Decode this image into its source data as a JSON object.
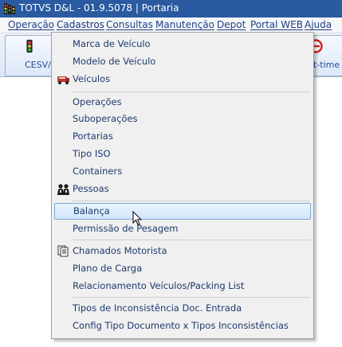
{
  "window": {
    "title": "TOTVS D&L - 01.9.5078 | Portaria"
  },
  "menubar": {
    "items": [
      "Operação",
      "Cadastros",
      "Consultas",
      "Manutenção",
      "Depot",
      "Portal WEB",
      "Ajuda"
    ]
  },
  "toolbar": {
    "left_label": "CESV/C",
    "right_label": "t-time"
  },
  "dropdown": {
    "items": [
      {
        "label": "Marca de Veículo"
      },
      {
        "label": "Modelo de Veículo"
      },
      {
        "label": "Veículos",
        "icon": "truck-icon"
      },
      {
        "label": "Operações"
      },
      {
        "label": "Suboperações"
      },
      {
        "label": "Portarias"
      },
      {
        "label": "Tipo ISO"
      },
      {
        "label": "Containers"
      },
      {
        "label": "Pessoas",
        "icon": "people-icon"
      },
      {
        "label": "Balança",
        "highlighted": true
      },
      {
        "label": "Permissão de Pesagem"
      },
      {
        "label": "Chamados Motorista",
        "icon": "documents-icon"
      },
      {
        "label": "Plano de Carga"
      },
      {
        "label": "Relacionamento Veículos/Packing List"
      },
      {
        "label": "Tipos de Inconsistência Doc. Entrada"
      },
      {
        "label": "Config Tipo Documento x Tipos Inconsistências"
      }
    ]
  },
  "colors": {
    "titlebar": "#2a5aa0",
    "menu_text": "#1f3f86",
    "highlight_border": "#7ea7d8"
  }
}
